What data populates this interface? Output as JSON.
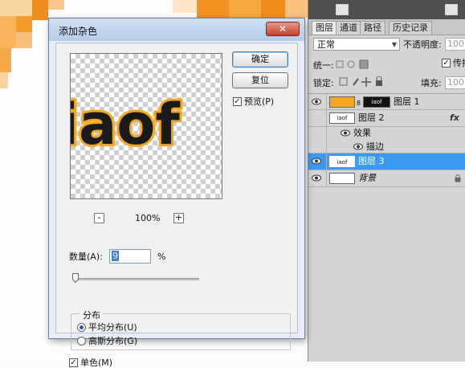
{
  "dialog": {
    "title": "添加杂色",
    "close_symbol": "✕",
    "ok_label": "确定",
    "reset_label": "复位",
    "preview_label": "预览(P)",
    "preview_checked": true,
    "zoom_out_symbol": "-",
    "zoom_in_symbol": "+",
    "zoom_level": "100%",
    "amount_label": "数量(A):",
    "amount_value": "9",
    "amount_unit": "%",
    "amount_fraction": 0.02,
    "distribution_label": "分布",
    "uniform_label": "平均分布(U)",
    "gaussian_label": "高斯分布(G)",
    "selected_distribution": "uniform",
    "monochromatic_label": "单色(M)",
    "monochromatic_checked": true,
    "preview_text": "iaof"
  },
  "layers_panel": {
    "tabs": [
      "图层",
      "通道",
      "路径",
      "历史记录"
    ],
    "active_tab": 0,
    "blend_mode": "正常",
    "opacity_label": "不透明度:",
    "opacity_value": "100",
    "unify_label": "统一:",
    "propagate_label": "传播",
    "lock_label": "锁定:",
    "fill_label": "填充:",
    "fill_value": "100",
    "layers": [
      {
        "name": "图层 1",
        "selected": false,
        "thumb_text": "iaof"
      },
      {
        "name": "图层 2",
        "selected": false,
        "thumb_text": "iaof",
        "fx": "fx"
      },
      {
        "name": "效果",
        "effect": true
      },
      {
        "name": "描边",
        "effect": true
      },
      {
        "name": "图层 3",
        "selected": true,
        "thumb_text": "iaof"
      },
      {
        "name": "背景",
        "selected": false,
        "locked": true
      }
    ]
  },
  "colors": {
    "selection_blue": "#3b9af4",
    "orange": "#f5a623",
    "dialog_title": "#c7d9ef"
  }
}
